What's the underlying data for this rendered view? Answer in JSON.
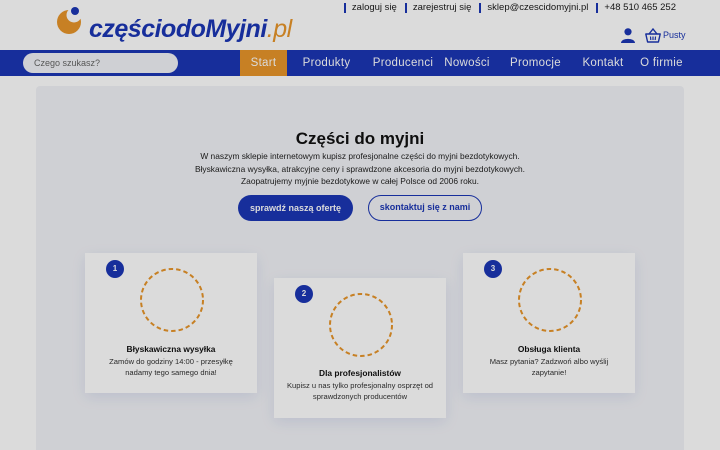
{
  "brand": {
    "name_main": "częściodoMyjni",
    "name_tld": ".pl",
    "colors": {
      "blue": "#1b36b5",
      "orange": "#e8962a",
      "panel": "#f2f3f7"
    }
  },
  "top_links": [
    "zaloguj się",
    "zarejestruj się",
    "sklep@czescidomyjni.pl",
    "+48 510 465 252"
  ],
  "account": {
    "icon": "user-icon"
  },
  "cart": {
    "icon": "basket-icon",
    "label": "Pusty"
  },
  "search": {
    "placeholder": "Czego szukasz?",
    "value": ""
  },
  "nav": [
    "Start",
    "Produkty",
    "Producenci",
    "Nowości",
    "Promocje",
    "Kontakt",
    "O firmie"
  ],
  "nav_active": "Start",
  "hero": {
    "title": "Części do myjni",
    "description": "W naszym sklepie internetowym kupisz profesjonalne części do myjni bezdotykowych. Błyskawiczna wysyłka, atrakcyjne ceny i sprawdzone akcesoria do myjni bezdotykowych. Zaopatrujemy myjnie bezdotykowe w całej Polsce od 2006 roku.",
    "primary_button": "sprawdź naszą ofertę",
    "secondary_button": "skontaktuj się z nami"
  },
  "features": [
    {
      "number": "1",
      "title": "Błyskawiczna wysyłka",
      "text": "Zamów do godziny 14:00 - przesyłkę nadamy tego samego dnia!"
    },
    {
      "number": "2",
      "title": "Dla profesjonalistów",
      "text": "Kupisz u nas tylko profesjonalny osprzęt od sprawdzonych producentów"
    },
    {
      "number": "3",
      "title": "Obsługa klienta",
      "text": "Masz pytania? Zadzwoń albo wyślij zapytanie!"
    }
  ]
}
